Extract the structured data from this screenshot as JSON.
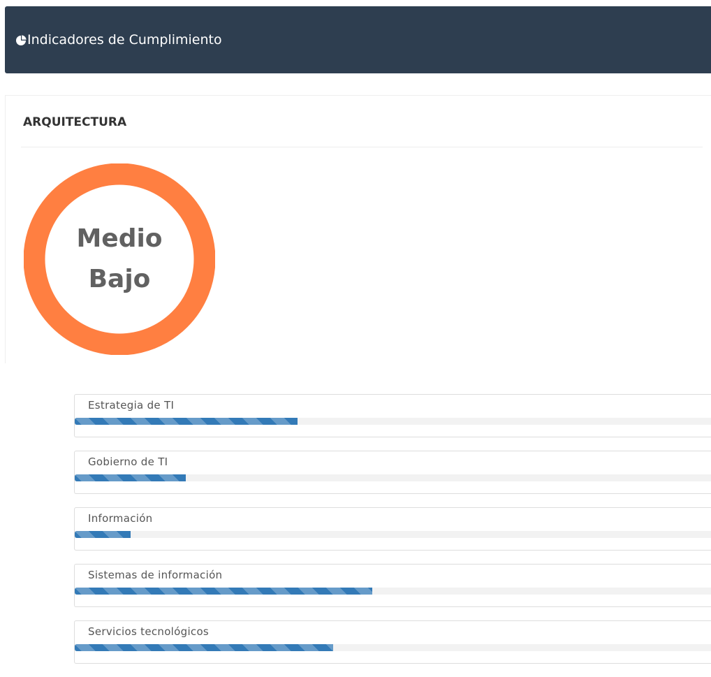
{
  "header": {
    "title": "Indicadores de Cumplimiento",
    "icon": "pie-chart-icon"
  },
  "panel": {
    "title": "ARQUITECTURA",
    "gauge": {
      "label_line1": "Medio",
      "label_line2": "Bajo",
      "ring_color": "#ff7f41"
    }
  },
  "progress": {
    "fill_color": "#337ab7",
    "items": [
      {
        "label": "Estrategia de TI",
        "value": 35
      },
      {
        "label": "Gobierno de TI",
        "value": 17.5
      },
      {
        "label": "Información",
        "value": 8.8
      },
      {
        "label": "Sistemas de información",
        "value": 46.8
      },
      {
        "label": "Servicios tecnológicos",
        "value": 40.6
      }
    ]
  }
}
